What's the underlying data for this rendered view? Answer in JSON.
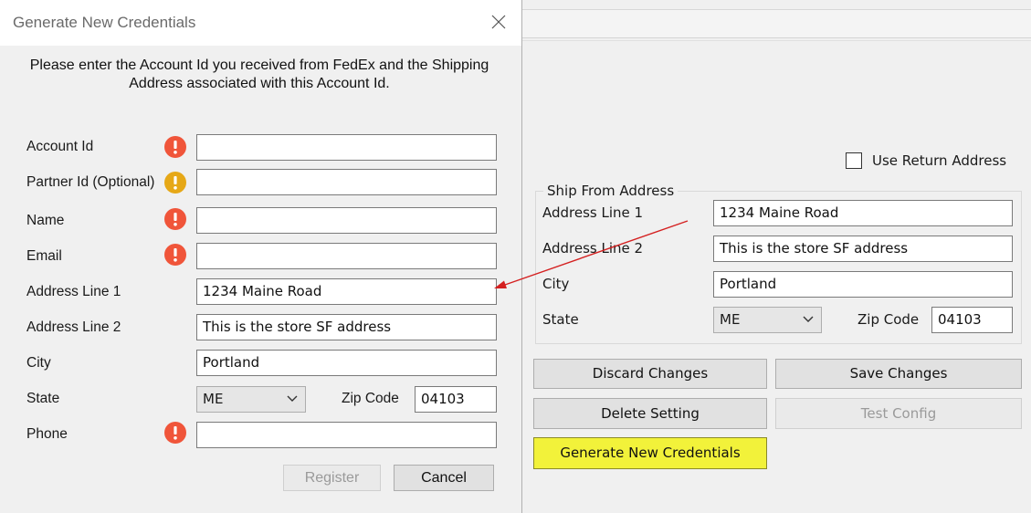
{
  "dialog": {
    "title": "Generate New Credentials",
    "instructions": "Please enter the Account Id you received from FedEx and the Shipping Address associated with this Account Id.",
    "fields": [
      {
        "label": "Account Id",
        "value": "",
        "warning": "red"
      },
      {
        "label": "Partner Id (Optional)",
        "value": "",
        "warning": "yellow"
      },
      {
        "label": "Name",
        "value": "",
        "warning": "red"
      },
      {
        "label": "Email",
        "value": "",
        "warning": "red"
      },
      {
        "label": "Address Line 1",
        "value": "1234 Maine Road"
      },
      {
        "label": "Address Line 2",
        "value": "This is the store SF address"
      },
      {
        "label": "City",
        "value": "Portland"
      }
    ],
    "state": {
      "label": "State",
      "value": "ME"
    },
    "zip": {
      "label": "Zip Code",
      "value": "04103"
    },
    "phone": {
      "label": "Phone",
      "value": "",
      "warning": "red"
    },
    "register_label": "Register",
    "cancel_label": "Cancel"
  },
  "settings": {
    "use_return_address_label": "Use Return Address",
    "use_return_address_checked": false,
    "ship_from": {
      "title": "Ship From Address",
      "address1_label": "Address Line 1",
      "address1_value": "1234 Maine Road",
      "address2_label": "Address Line 2",
      "address2_value": "This is the store SF address",
      "city_label": "City",
      "city_value": "Portland",
      "state_label": "State",
      "state_value": "ME",
      "zip_label": "Zip Code",
      "zip_value": "04103"
    },
    "buttons": {
      "discard": "Discard Changes",
      "save": "Save Changes",
      "delete": "Delete Setting",
      "test": "Test Config",
      "generate": "Generate New Credentials"
    }
  },
  "colors": {
    "warning_red": "#f0553a",
    "warning_yellow": "#e6a817",
    "highlight_button": "#f2f23a",
    "annotation_arrow": "#d42020"
  },
  "icons": {
    "close": "close-icon",
    "chevron": "chevron-down-icon",
    "warning": "exclamation-warning-icon"
  }
}
